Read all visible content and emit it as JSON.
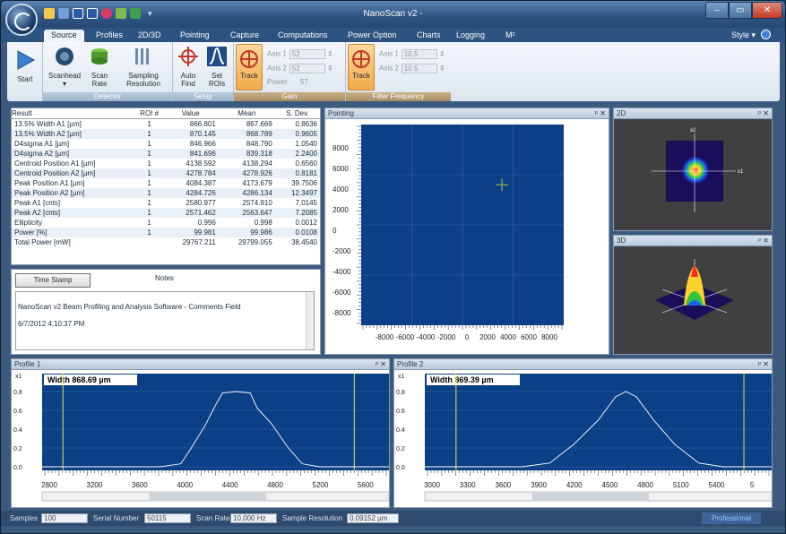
{
  "window": {
    "title": "NanoScan v2 -",
    "style_label": "Style",
    "minimize": "–",
    "maximize": "▭",
    "close": "✕"
  },
  "tabs": [
    "Source",
    "Profiles",
    "2D/3D",
    "Pointing",
    "Capture",
    "Computations",
    "Power Option",
    "Charts",
    "Logging",
    "M²"
  ],
  "ribbon": {
    "start": "Start",
    "scanhead": "Scanhead",
    "scan_rate": "Scan Rate",
    "sampling": "Sampling Resolution",
    "detector_group": "Detector",
    "auto_find": "Auto Find",
    "set_rois": "Set ROIs",
    "setup_group": "Setup",
    "track": "Track",
    "gain_axis1_label": "Axis 1",
    "gain_axis1_value": "52",
    "gain_axis2_label": "Axis 2",
    "gain_axis2_value": "52",
    "power_label": "Power",
    "power_value": "57",
    "gain_group": "Gain",
    "filter_axis1_label": "Axis 1",
    "filter_axis1_value": "10.5",
    "filter_axis2_label": "Axis 2",
    "filter_axis2_value": "10.5",
    "filter_group": "Filter Frequency"
  },
  "results": {
    "headers": [
      "Result",
      "ROI #",
      "Value",
      "Mean",
      "S. Dev."
    ],
    "rows": [
      [
        "13.5% Width A1 [µm]",
        "1",
        "866.801",
        "867.669",
        "0.8636"
      ],
      [
        "13.5% Width A2 [µm]",
        "1",
        "870.145",
        "868.789",
        "0.9605"
      ],
      [
        "D4sigma A1 [µm]",
        "1",
        "846.966",
        "848.790",
        "1.0540"
      ],
      [
        "D4sigma A2 [µm]",
        "1",
        "841.696",
        "839.318",
        "2.2400"
      ],
      [
        "Centroid Position A1 [µm]",
        "1",
        "4138.592",
        "4138.294",
        "0.6560"
      ],
      [
        "Centroid Position A2 [µm]",
        "1",
        "4278.784",
        "4278.926",
        "0.8181"
      ],
      [
        "Peak Position A1 [µm]",
        "1",
        "4084.387",
        "4173.679",
        "39.7506"
      ],
      [
        "Peak Position A2 [µm]",
        "1",
        "4284.726",
        "4286.134",
        "12.3497"
      ],
      [
        "Peak A1 [cnts]",
        "1",
        "2580.977",
        "2574.910",
        "7.0145"
      ],
      [
        "Peak A2 [cnts]",
        "1",
        "2571.462",
        "2563.647",
        "7.2085"
      ],
      [
        "Ellipticity",
        "1",
        "0.996",
        "0.998",
        "0.0012"
      ],
      [
        "Power [%]",
        "1",
        "99.981",
        "99.986",
        "0.0108"
      ],
      [
        "Total Power [mW]",
        "",
        "29767.211",
        "29799.055",
        "38.4540"
      ]
    ]
  },
  "notes": {
    "timestamp_button": "Time Stamp",
    "title": "Notes",
    "line1": "NanoScan v2 Beam Profiling and Analysis Software - Comments Field",
    "line2": "6/7/2012 4:10:37 PM"
  },
  "pointing": {
    "title": "Pointing",
    "yticks": [
      "8000",
      "6000",
      "4000",
      "2000",
      "0",
      "-2000",
      "-4000",
      "-6000",
      "-8000"
    ],
    "xticks": [
      "-8000",
      "-6000",
      "-4000",
      "-2000",
      "0",
      "2000",
      "4000",
      "6000",
      "8000"
    ]
  },
  "view2d": {
    "title": "2D",
    "axis_x": "x1",
    "axis_y": "x2"
  },
  "view3d": {
    "title": "3D"
  },
  "profile1": {
    "title": "Profile 1",
    "axis": "x1",
    "width_label": "Width 868.69 µm",
    "yticks": [
      "0.8",
      "0.6",
      "0.4",
      "0.2",
      "0.0"
    ],
    "xticks": [
      "2800",
      "3200",
      "3600",
      "4000",
      "4400",
      "4800",
      "5200",
      "5600"
    ]
  },
  "profile2": {
    "title": "Profile 2",
    "axis": "x1",
    "width_label": "Width 869.39 µm",
    "yticks": [
      "0.8",
      "0.6",
      "0.4",
      "0.2",
      "0.0"
    ],
    "xticks": [
      "3000",
      "3300",
      "3600",
      "3900",
      "4200",
      "4500",
      "4800",
      "5100",
      "5400",
      "5"
    ]
  },
  "status": {
    "samples_label": "Samples",
    "samples_value": "100",
    "serial_label": "Serial Number",
    "serial_value": "50115",
    "scanrate_label": "Scan Rate",
    "scanrate_value": "10.000 Hz",
    "resolution_label": "Sample Resolution",
    "resolution_value": "0.09152 µm",
    "edition": "Professional"
  },
  "colors": {
    "plot_bg": "#0b3f86",
    "accent": "#f0a63c",
    "marker": "#d9e640"
  }
}
